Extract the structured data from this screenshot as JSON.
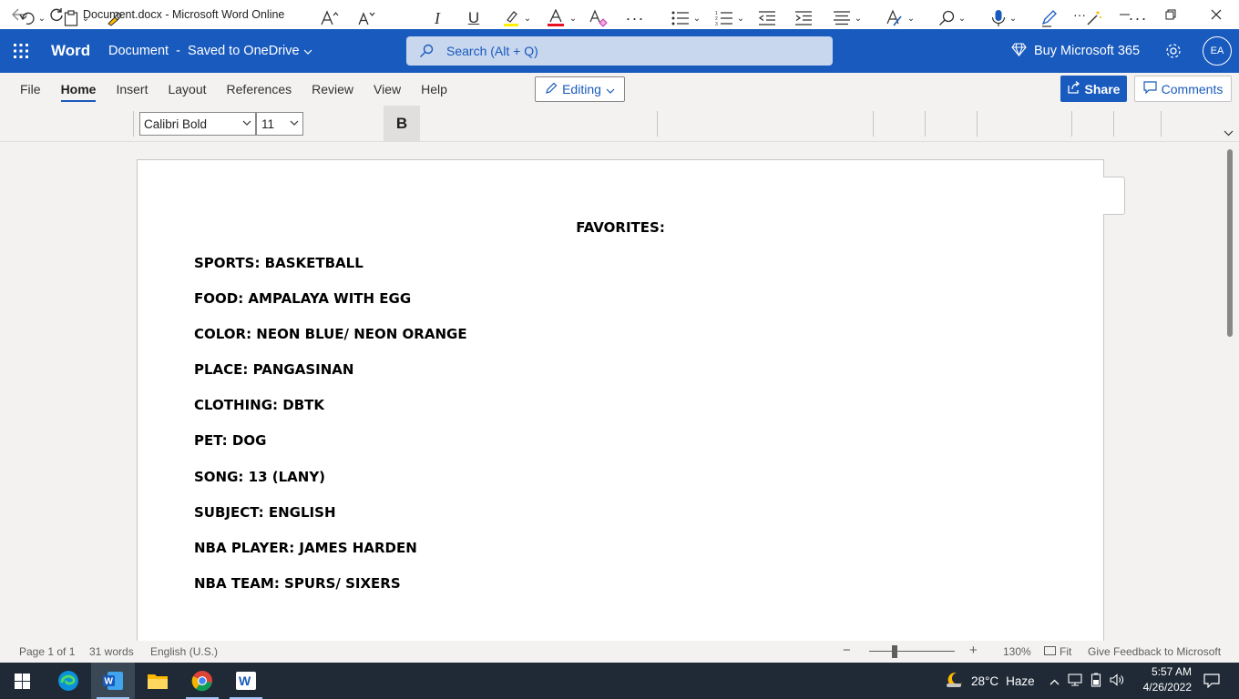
{
  "window": {
    "title": "Document.docx - Microsoft Word Online",
    "controls": {
      "more": "···"
    }
  },
  "header": {
    "app_name": "Word",
    "doc_status": "Document  -  Saved to OneDrive",
    "search_placeholder": "Search (Alt + Q)",
    "buy_label": "Buy Microsoft 365",
    "avatar_initials": "EA",
    "brand_color": "#185abd"
  },
  "tabs": [
    {
      "label": "File"
    },
    {
      "label": "Home",
      "active": true
    },
    {
      "label": "Insert"
    },
    {
      "label": "Layout"
    },
    {
      "label": "References"
    },
    {
      "label": "Review"
    },
    {
      "label": "View"
    },
    {
      "label": "Help"
    }
  ],
  "mode": {
    "label": "Editing"
  },
  "share": {
    "label": "Share"
  },
  "comments": {
    "label": "Comments"
  },
  "ribbon": {
    "font_name": "Calibri Bold",
    "font_size": "11",
    "bold_active": true,
    "highlight_color": "#ffef00",
    "font_color": "#e81123"
  },
  "document": {
    "title": "FAVORITES:",
    "lines": [
      "SPORTS: BASKETBALL",
      "FOOD: AMPALAYA WITH EGG",
      "COLOR: NEON BLUE/ NEON ORANGE",
      "PLACE: PANGASINAN",
      "CLOTHING: DBTK",
      "PET: DOG",
      "SONG: 13 (LANY)",
      "SUBJECT: ENGLISH",
      "NBA PLAYER: JAMES HARDEN",
      "NBA TEAM: SPURS/ SIXERS"
    ]
  },
  "statusbar": {
    "page": "Page 1 of 1",
    "words": "31 words",
    "language": "English (U.S.)",
    "zoom": "130%",
    "fit": "Fit",
    "feedback": "Give Feedback to Microsoft"
  },
  "taskbar": {
    "weather_temp": "28°C",
    "weather_desc": "Haze",
    "time": "5:57 AM",
    "date": "4/26/2022"
  }
}
